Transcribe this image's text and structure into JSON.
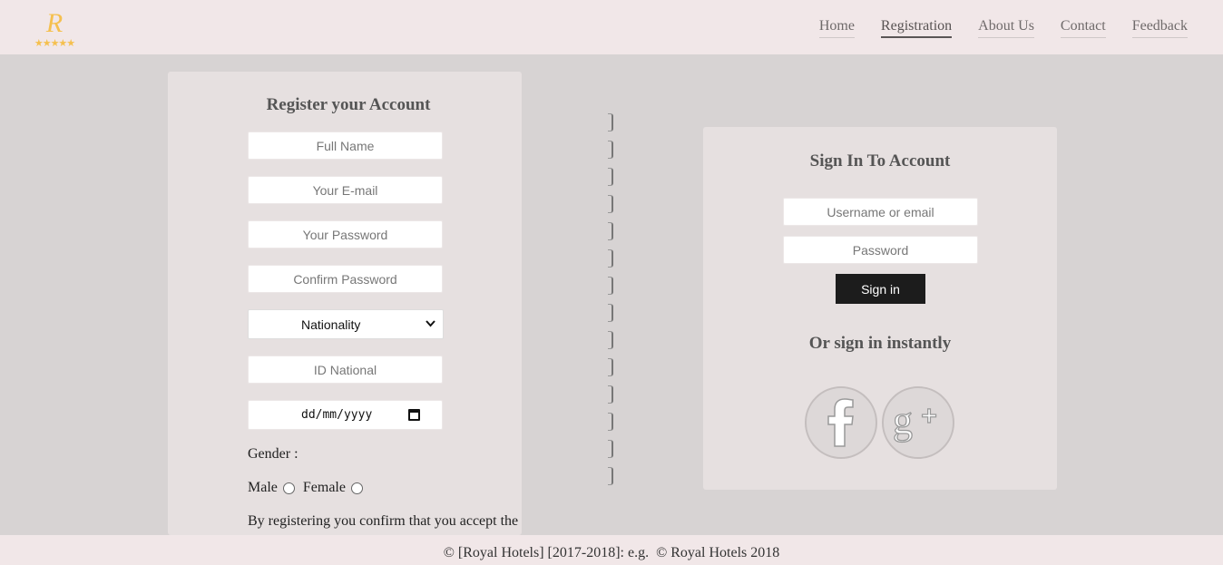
{
  "logo": {
    "letter": "R",
    "stars": "★★★★★"
  },
  "nav": {
    "items": [
      {
        "label": "Home"
      },
      {
        "label": "Registration"
      },
      {
        "label": "About Us"
      },
      {
        "label": "Contact"
      },
      {
        "label": "Feedback"
      }
    ],
    "active": "Registration"
  },
  "register": {
    "title": "Register your Account",
    "full_name_placeholder": "Full Name",
    "email_placeholder": "Your E-mail",
    "password_placeholder": "Your Password",
    "confirm_password_placeholder": "Confirm Password",
    "nationality_selected": "Nationality",
    "id_placeholder": "ID National",
    "date_placeholder": "dd/mm/yyyy",
    "gender_label": "Gender :",
    "male_label": "Male",
    "female_label": "Female",
    "terms_text": "By registering you confirm that you accept the"
  },
  "signin": {
    "title": "Sign In To Account",
    "username_placeholder": "Username or email",
    "password_placeholder": "Password",
    "button_label": "Sign in",
    "instant_title": "Or sign in instantly",
    "social": [
      "facebook-icon",
      "google-plus-icon"
    ]
  },
  "footer": {
    "text": "© [Royal Hotels] [2017-2018]: e.g.  © Royal Hotels 2018"
  },
  "colors": {
    "gold": "#f5c04f",
    "button": "#1c1c1c",
    "panel": "#e6e0e0",
    "background": "#d7d3d3",
    "header": "#f1e7e8"
  }
}
